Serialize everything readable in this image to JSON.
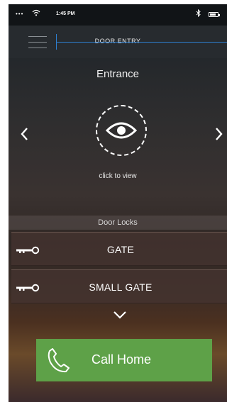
{
  "status_bar": {
    "signal": "•••",
    "time": "1:45 PM"
  },
  "header": {
    "title": "DOOR ENTRY"
  },
  "camera": {
    "name": "Entrance",
    "view_hint": "click to view",
    "prev_glyph": "<",
    "next_glyph": ">"
  },
  "locks": {
    "title": "Door Locks",
    "items": [
      {
        "label": "GATE",
        "icon": "key-icon"
      },
      {
        "label": "SMALL GATE",
        "icon": "key-icon"
      }
    ]
  },
  "call": {
    "label": "Call Home",
    "icon": "phone-icon"
  },
  "colors": {
    "call_button": "#5ea148",
    "header_line": "#2d7fd0"
  }
}
